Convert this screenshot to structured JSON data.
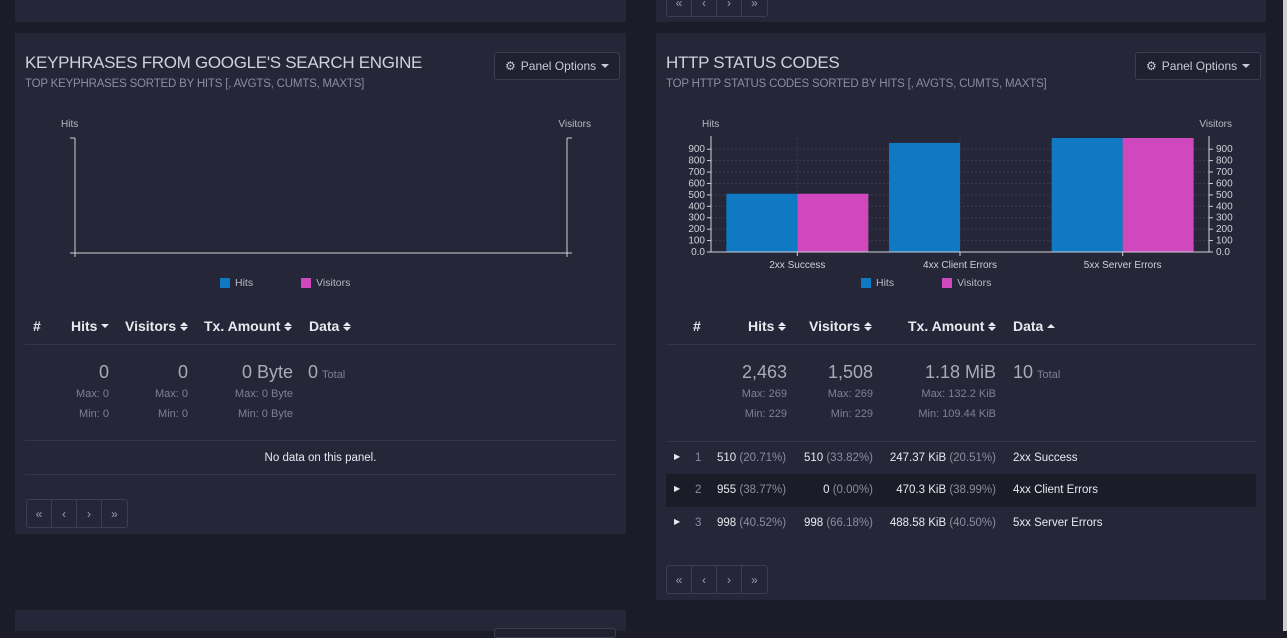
{
  "colors": {
    "hits": "#0f7ac3",
    "visitors": "#cf48bd",
    "panel": "#252738",
    "bg": "#1c1c29"
  },
  "pager": {
    "first": "«",
    "prev": "‹",
    "next": "›",
    "last": "»"
  },
  "keyphrases": {
    "title": "KEYPHRASES FROM GOOGLE'S SEARCH ENGINE",
    "subtitle": "TOP KEYPHRASES SORTED BY HITS [, AVGTS, CUMTS, MAXTS]",
    "options_label": "Panel Options",
    "chart": {
      "left_axis": "Hits",
      "right_axis": "Visitors"
    },
    "legend": {
      "hits": "Hits",
      "visitors": "Visitors"
    },
    "columns": {
      "num": "#",
      "hits": "Hits",
      "visitors": "Visitors",
      "tx": "Tx. Amount",
      "data": "Data"
    },
    "totals": {
      "hits": "0",
      "hits_max": "Max: 0",
      "hits_min": "Min: 0",
      "visitors": "0",
      "visitors_max": "Max: 0",
      "visitors_min": "Min: 0",
      "tx": "0 Byte",
      "tx_max": "Max: 0 Byte",
      "tx_min": "Min: 0 Byte",
      "data": "0",
      "data_label": "Total"
    },
    "empty": "No data on this panel."
  },
  "http": {
    "title": "HTTP STATUS CODES",
    "subtitle": "TOP HTTP STATUS CODES SORTED BY HITS [, AVGTS, CUMTS, MAXTS]",
    "options_label": "Panel Options",
    "legend": {
      "hits": "Hits",
      "visitors": "Visitors"
    },
    "columns": {
      "num": "#",
      "hits": "Hits",
      "visitors": "Visitors",
      "tx": "Tx. Amount",
      "data": "Data"
    },
    "totals": {
      "hits": "2,463",
      "hits_max": "Max: 269",
      "hits_min": "Min: 229",
      "visitors": "1,508",
      "visitors_max": "Max: 269",
      "visitors_min": "Min: 229",
      "tx": "1.18 MiB",
      "tx_max": "Max: 132.2 KiB",
      "tx_min": "Min: 109.44 KiB",
      "data": "10",
      "data_label": "Total"
    },
    "rows": [
      {
        "num": "1",
        "hits": "510",
        "hits_pct": "(20.71%)",
        "visitors": "510",
        "visitors_pct": "(33.82%)",
        "tx": "247.37 KiB",
        "tx_pct": "(20.51%)",
        "data": "2xx Success"
      },
      {
        "num": "2",
        "hits": "955",
        "hits_pct": "(38.77%)",
        "visitors": "0",
        "visitors_pct": "(0.00%)",
        "tx": "470.3 KiB",
        "tx_pct": "(38.99%)",
        "data": "4xx Client Errors"
      },
      {
        "num": "3",
        "hits": "998",
        "hits_pct": "(40.52%)",
        "visitors": "998",
        "visitors_pct": "(66.18%)",
        "tx": "488.58 KiB",
        "tx_pct": "(40.50%)",
        "data": "5xx Server Errors"
      }
    ]
  },
  "chart_data": [
    {
      "type": "bar",
      "categories": [],
      "series": [],
      "xlabel": "",
      "ylabel": "Hits",
      "y2label": "Visitors"
    },
    {
      "type": "bar",
      "categories": [
        "2xx Success",
        "4xx Client Errors",
        "5xx Server Errors"
      ],
      "series": [
        {
          "name": "Hits",
          "values": [
            510,
            955,
            998
          ]
        },
        {
          "name": "Visitors",
          "values": [
            510,
            0,
            998
          ]
        }
      ],
      "ylabel": "Hits",
      "y2label": "Visitors",
      "ylim": [
        0,
        998
      ],
      "yticks": [
        "0.0",
        "100",
        "200",
        "300",
        "400",
        "500",
        "600",
        "700",
        "800",
        "900"
      ],
      "y2ticks": [
        "0.0",
        "100",
        "200",
        "300",
        "400",
        "500",
        "600",
        "700",
        "800",
        "900"
      ],
      "grid": true,
      "legend": "bottom"
    }
  ]
}
